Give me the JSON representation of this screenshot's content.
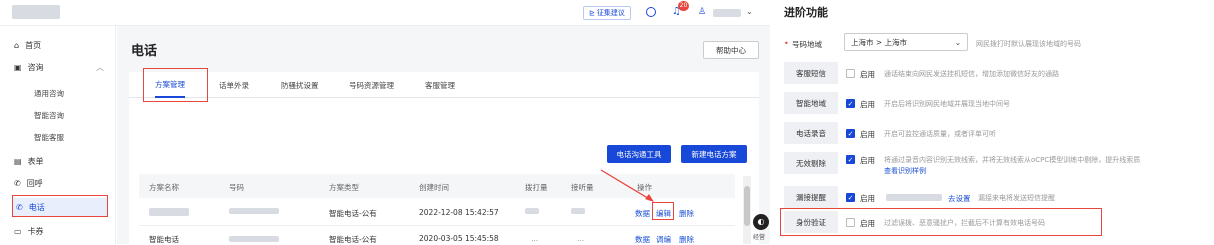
{
  "header": {
    "feedback_label": "征集建议",
    "badge_count": "20"
  },
  "sidebar": {
    "items": [
      {
        "label": "首页",
        "icon": "home-icon"
      },
      {
        "label": "咨询",
        "icon": "chat-icon"
      },
      {
        "label": "通用咨询"
      },
      {
        "label": "智能咨询"
      },
      {
        "label": "智能客服"
      },
      {
        "label": "表单",
        "icon": "form-icon"
      },
      {
        "label": "回呼",
        "icon": "callback-icon"
      },
      {
        "label": "电话",
        "icon": "phone-icon"
      },
      {
        "label": "卡券",
        "icon": "coupon-icon"
      }
    ]
  },
  "main": {
    "title": "电话",
    "help_label": "帮助中心",
    "tabs": [
      "方案管理",
      "话单外录",
      "防骚扰设置",
      "号码资源管理",
      "客服管理"
    ],
    "buttons": {
      "tool": "电话沟通工具",
      "new": "新建电话方案"
    },
    "columns": [
      "方案名称",
      "号码",
      "方案类型",
      "创建时间",
      "拨打量",
      "接听量",
      "操作"
    ],
    "rows": [
      {
        "name": "",
        "number": "",
        "type": "智能电话-公有",
        "created": "2022-12-08 15:42:57",
        "dial": "",
        "answer": "",
        "actions": [
          "数据",
          "编辑",
          "删除"
        ]
      },
      {
        "name": "智能电话",
        "number": "",
        "type": "智能电话-公有",
        "created": "2020-03-05 15:45:58",
        "dial": "...",
        "answer": "...",
        "actions": [
          "数据",
          "调编",
          "删除"
        ]
      }
    ],
    "float_label": "经营"
  },
  "right": {
    "title": "进阶功能",
    "rows": [
      {
        "label": "号码地域",
        "required": true,
        "select": "上海市 > 上海市",
        "hint": "网民拨打时默认展现该地域的号码"
      },
      {
        "label": "客服短信",
        "checked": false,
        "check_label": "启用",
        "hint": "通话结束向网民发送挂机短信，增加添加微信好友的通路"
      },
      {
        "label": "智能地域",
        "checked": true,
        "check_label": "启用",
        "hint": "开启后将识别网民地域并展现当地中间号"
      },
      {
        "label": "电话录音",
        "checked": true,
        "check_label": "启用",
        "hint": "开启可监控通话质量，或者评单可听"
      },
      {
        "label": "无效剔除",
        "checked": true,
        "check_label": "启用",
        "hint": "将通过录音内容识别无效线索，并将无效线索从oCPC模型训练中剔除，提升线索质",
        "link": "查看识别样例"
      },
      {
        "label": "漏接提醒",
        "checked": true,
        "check_label": "启用",
        "setup": "去设置",
        "hint": "漏接来电将发送短信提醒"
      },
      {
        "label": "身份验证",
        "checked": false,
        "check_label": "启用",
        "hint": "过滤误拨、恶意骚扰户，拦截后不计算有效电话号码"
      }
    ]
  }
}
